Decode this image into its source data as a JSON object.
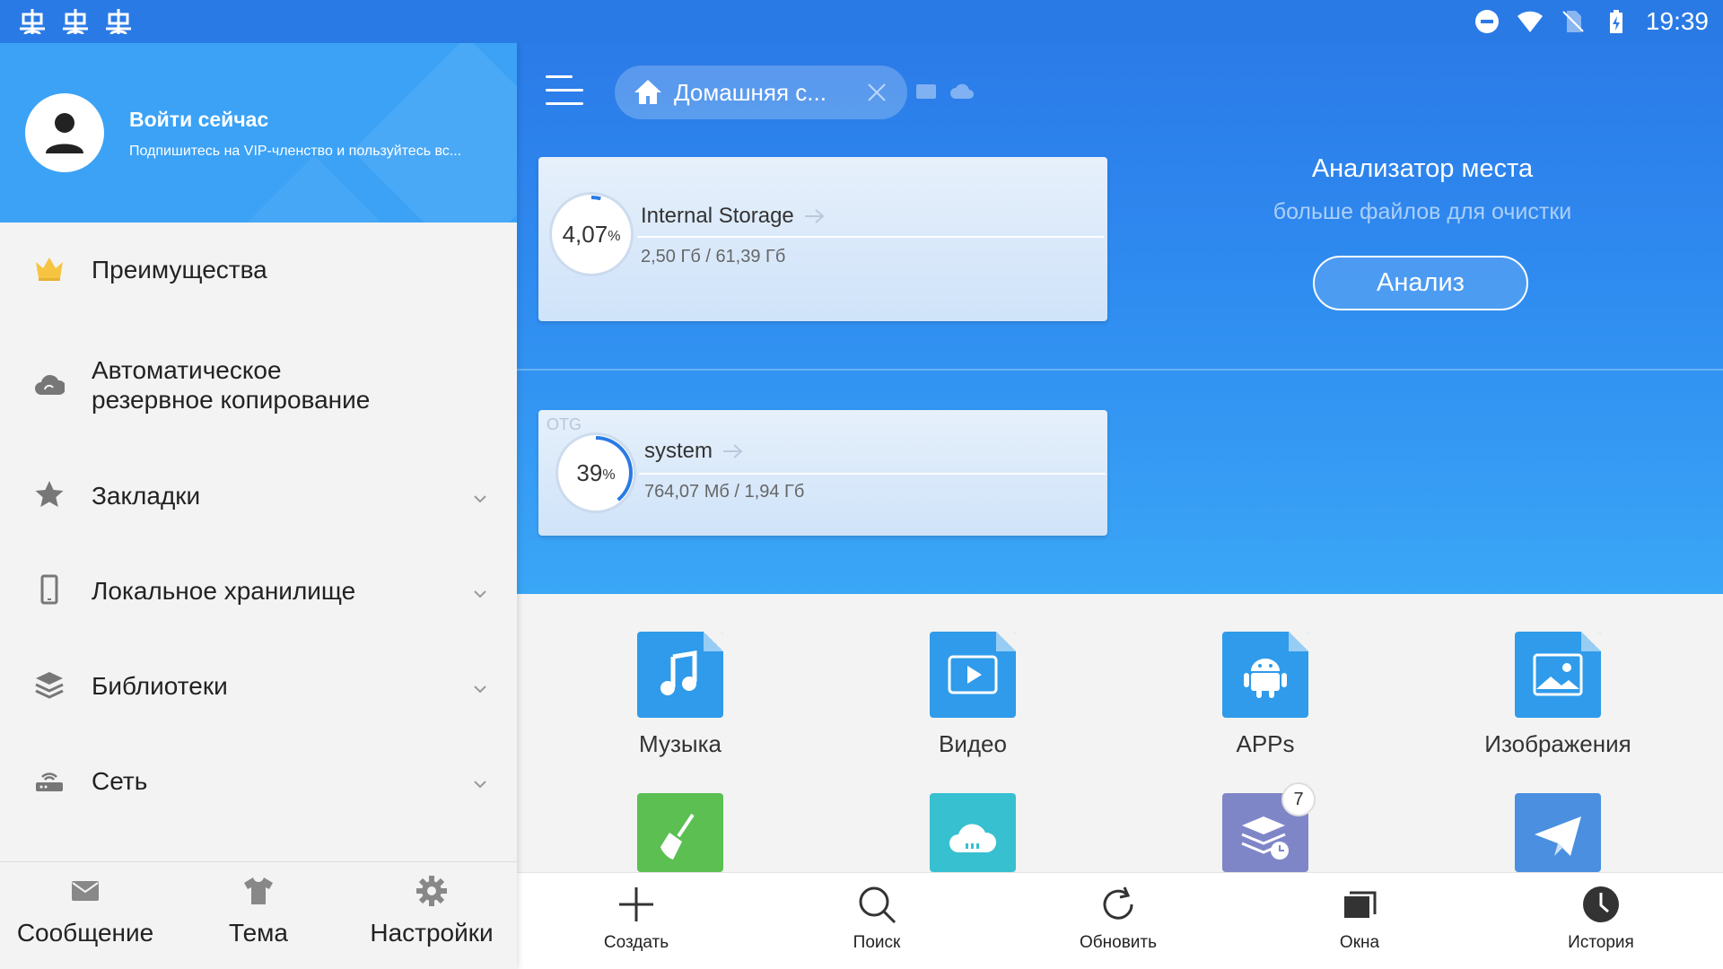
{
  "status_bar": {
    "time": "19:39"
  },
  "header": {
    "tab_label": "Домашняя с...",
    "accent": "#2a7ae6"
  },
  "storage": {
    "internal": {
      "percent_num": "4,07",
      "percent_sign": "%",
      "percent_value": 4.07,
      "name": "Internal Storage",
      "usage": "2,50 Гб / 61,39 Гб"
    },
    "system": {
      "tag": "OTG",
      "percent_num": "39",
      "percent_sign": "%",
      "percent_value": 39,
      "name": "system",
      "usage": "764,07 Мб / 1,94 Гб"
    }
  },
  "analyzer": {
    "title": "Анализатор места",
    "subtitle": "больше файлов для очистки",
    "button": "Анализ"
  },
  "categories": [
    {
      "label": "Музыка",
      "icon": "music-icon",
      "color": "#2f9bea"
    },
    {
      "label": "Видео",
      "icon": "video-icon",
      "color": "#2f9bea"
    },
    {
      "label": "APPs",
      "icon": "android-icon",
      "color": "#2f9bea"
    },
    {
      "label": "Изображения",
      "icon": "image-icon",
      "color": "#2f9bea"
    },
    {
      "label": "",
      "icon": "broom-icon",
      "color": "#5cbf52"
    },
    {
      "label": "",
      "icon": "cloud-icon",
      "color": "#37c0d0"
    },
    {
      "label": "",
      "icon": "layers-clock-icon",
      "color": "#7f86c8",
      "badge": "7"
    },
    {
      "label": "",
      "icon": "send-icon",
      "color": "#4a8fe0"
    }
  ],
  "toolbar": {
    "create": "Создать",
    "search": "Поиск",
    "refresh": "Обновить",
    "windows": "Окна",
    "history": "История"
  },
  "sidebar": {
    "login_title": "Войти сейчас",
    "login_subtitle": "Подпишитесь на VIP-членство и пользуйтесь вс...",
    "items": [
      {
        "line1": "Преимущества",
        "line2": ""
      },
      {
        "line1": "Автоматическое",
        "line2": "резервное копирование"
      },
      {
        "line1": "Закладки",
        "line2": ""
      },
      {
        "line1": "Локальное хранилище",
        "line2": ""
      },
      {
        "line1": "Библиотеки",
        "line2": ""
      },
      {
        "line1": "Сеть",
        "line2": ""
      }
    ],
    "bottom": {
      "message": "Сообщение",
      "theme": "Тема",
      "settings": "Настройки"
    }
  }
}
